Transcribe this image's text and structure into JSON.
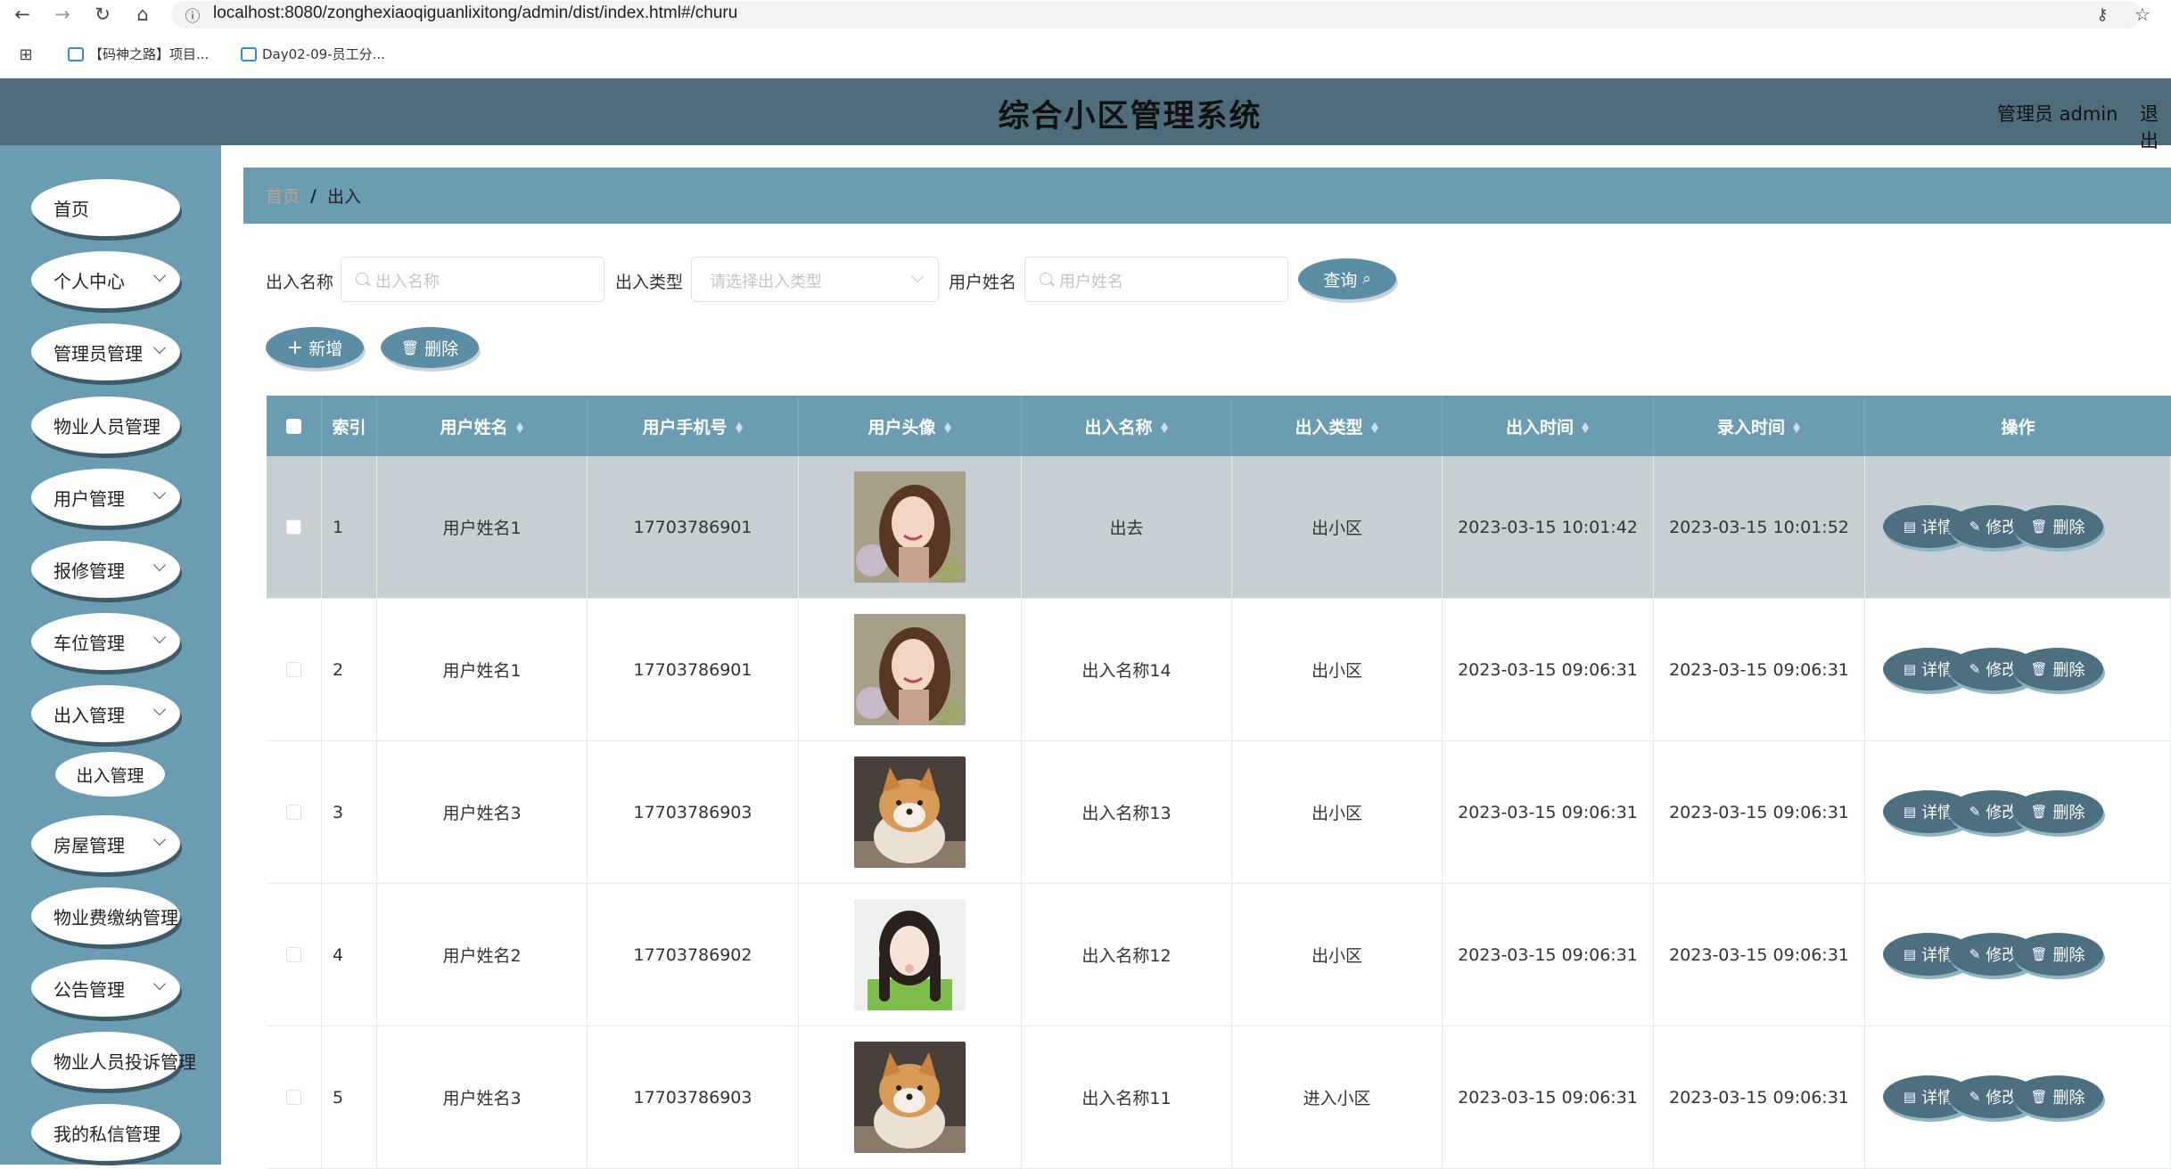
{
  "browser": {
    "url": "localhost:8080/zonghexiaoqiguanlixitong/admin/dist/index.html#/churu",
    "bookmarks": [
      "【码神之路】项目...",
      "Day02-09-员工分..."
    ]
  },
  "header": {
    "title": "综合小区管理系统",
    "admin_label": "管理员 admin",
    "logout": "退出"
  },
  "sidebar": {
    "items": [
      {
        "label": "首页"
      },
      {
        "label": "个人中心"
      },
      {
        "label": "管理员管理"
      },
      {
        "label": "物业人员管理"
      },
      {
        "label": "用户管理"
      },
      {
        "label": "报修管理"
      },
      {
        "label": "车位管理"
      },
      {
        "label": "出入管理"
      },
      {
        "label": "房屋管理"
      },
      {
        "label": "物业费缴纳管理"
      },
      {
        "label": "公告管理"
      },
      {
        "label": "物业人员投诉管理"
      },
      {
        "label": "我的私信管理"
      }
    ],
    "sub_item": "出入管理"
  },
  "breadcrumb": {
    "home": "首页",
    "separator": "/",
    "current": "出入"
  },
  "search": {
    "name_label": "出入名称",
    "name_placeholder": "出入名称",
    "type_label": "出入类型",
    "type_placeholder": "请选择出入类型",
    "user_label": "用户姓名",
    "user_placeholder": "用户姓名",
    "query_button": "查询"
  },
  "toolbar": {
    "add": "新增",
    "delete": "删除"
  },
  "table": {
    "headers": [
      "索引",
      "用户姓名",
      "用户手机号",
      "用户头像",
      "出入名称",
      "出入类型",
      "出入时间",
      "录入时间",
      "操作"
    ],
    "rows": [
      {
        "index": "1",
        "name": "用户姓名1",
        "phone": "17703786901",
        "avatar": "woman-flowers",
        "churu_name": "出去",
        "churu_type": "出小区",
        "churu_time": "2023-03-15 10:01:42",
        "entry_time": "2023-03-15 10:01:52"
      },
      {
        "index": "2",
        "name": "用户姓名1",
        "phone": "17703786901",
        "avatar": "woman-flowers",
        "churu_name": "出入名称14",
        "churu_type": "出小区",
        "churu_time": "2023-03-15 09:06:31",
        "entry_time": "2023-03-15 09:06:31"
      },
      {
        "index": "3",
        "name": "用户姓名3",
        "phone": "17703786903",
        "avatar": "shiba-dog",
        "churu_name": "出入名称13",
        "churu_type": "出小区",
        "churu_time": "2023-03-15 09:06:31",
        "entry_time": "2023-03-15 09:06:31"
      },
      {
        "index": "4",
        "name": "用户姓名2",
        "phone": "17703786902",
        "avatar": "girl-green",
        "churu_name": "出入名称12",
        "churu_type": "出小区",
        "churu_time": "2023-03-15 09:06:31",
        "entry_time": "2023-03-15 09:06:31"
      },
      {
        "index": "5",
        "name": "用户姓名3",
        "phone": "17703786903",
        "avatar": "shiba-dog",
        "churu_name": "出入名称11",
        "churu_type": "进入小区",
        "churu_time": "2023-03-15 09:06:31",
        "entry_time": "2023-03-15 09:06:31"
      }
    ],
    "actions": {
      "detail": "详情",
      "edit": "修改",
      "delete": "删除"
    }
  },
  "colors": {
    "header_bg": "#4f6c7b",
    "sidebar_bg": "#6b9db2",
    "button_bg": "#5b8ea4",
    "selected_row": "#c5cfd4"
  }
}
